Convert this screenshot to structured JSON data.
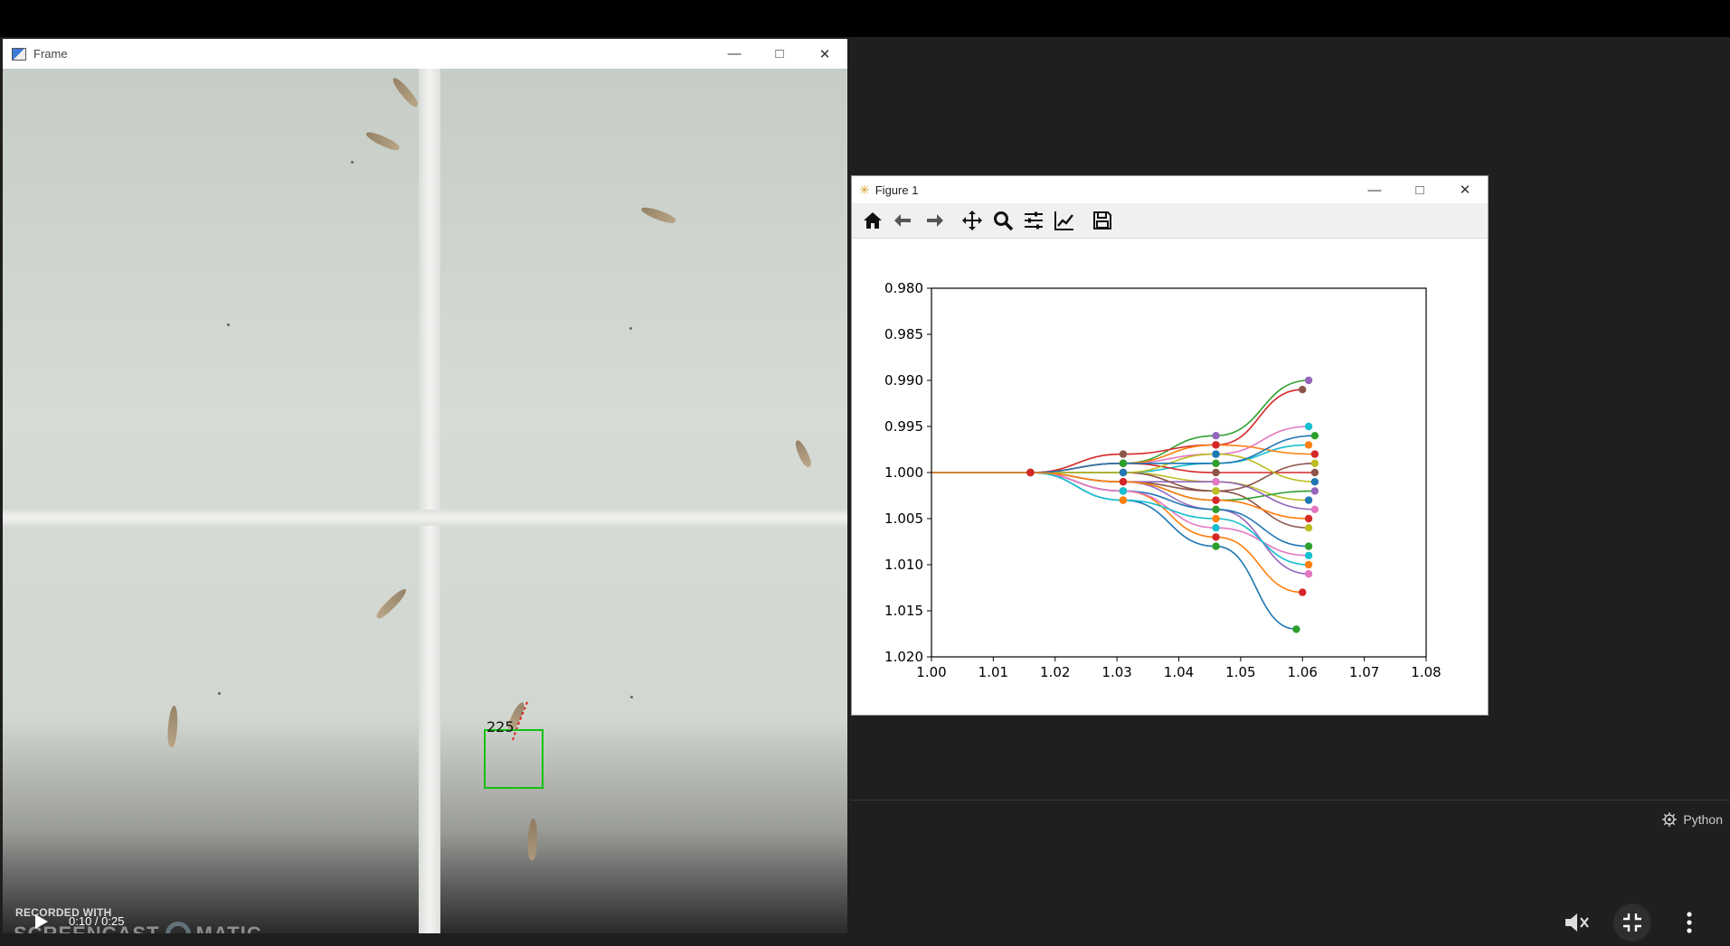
{
  "frame_window": {
    "title": "Frame",
    "track_label": "225"
  },
  "video_player": {
    "watermark_line1": "RECORDED WITH",
    "watermark_logo_left": "SCREENCAST",
    "watermark_logo_right": "MATIC",
    "time": "0:10 / 0:25"
  },
  "figure_window": {
    "title": "Figure 1",
    "toolbar": [
      "home-icon",
      "back-arrow-icon",
      "forward-arrow-icon",
      "pan-icon",
      "zoom-icon",
      "configure-subplots-icon",
      "edit-axis-icon",
      "save-icon"
    ]
  },
  "status_bar": {
    "language": "Python"
  },
  "chart_data": {
    "type": "line",
    "title": "",
    "xlabel": "",
    "ylabel": "",
    "xlim": [
      1.0,
      1.08
    ],
    "ylim": [
      0.98,
      1.02
    ],
    "y_inverted": true,
    "x_ticks": [
      "1.00",
      "1.01",
      "1.02",
      "1.03",
      "1.04",
      "1.05",
      "1.06",
      "1.07",
      "1.08"
    ],
    "y_ticks": [
      "0.980",
      "0.985",
      "0.990",
      "0.995",
      "1.000",
      "1.005",
      "1.010",
      "1.015",
      "1.020"
    ],
    "grid": false,
    "colors": [
      "#1f77b4",
      "#ff7f0e",
      "#2ca02c",
      "#d62728",
      "#9467bd",
      "#8c564b",
      "#e377c2",
      "#bcbd22",
      "#17becf"
    ],
    "series": [
      {
        "x": [
          1.0,
          1.016,
          1.031,
          1.046,
          1.059
        ],
        "y": [
          1.0,
          1.0,
          1.003,
          1.008,
          1.017
        ]
      },
      {
        "x": [
          1.0,
          1.016,
          1.031,
          1.046,
          1.06
        ],
        "y": [
          1.0,
          1.0,
          1.002,
          1.007,
          1.013
        ]
      },
      {
        "x": [
          1.0,
          1.016,
          1.031,
          1.046,
          1.061
        ],
        "y": [
          1.0,
          1.0,
          0.999,
          0.996,
          0.99
        ]
      },
      {
        "x": [
          1.0,
          1.016,
          1.031,
          1.046,
          1.06
        ],
        "y": [
          1.0,
          1.0,
          0.998,
          0.997,
          0.991
        ]
      },
      {
        "x": [
          1.0,
          1.016,
          1.031,
          1.046,
          1.061
        ],
        "y": [
          1.0,
          1.0,
          1.001,
          1.004,
          1.011
        ]
      },
      {
        "x": [
          1.0,
          1.016,
          1.031,
          1.046,
          1.061
        ],
        "y": [
          1.0,
          1.0,
          1.001,
          1.002,
          1.006
        ]
      },
      {
        "x": [
          1.0,
          1.016,
          1.031,
          1.046,
          1.061
        ],
        "y": [
          1.0,
          1.0,
          0.999,
          0.998,
          0.995
        ]
      },
      {
        "x": [
          1.0,
          1.016,
          1.031,
          1.046,
          1.061
        ],
        "y": [
          1.0,
          1.0,
          1.0,
          1.001,
          1.003
        ]
      },
      {
        "x": [
          1.0,
          1.016,
          1.031,
          1.046,
          1.061
        ],
        "y": [
          1.0,
          1.0,
          1.0,
          0.999,
          0.997
        ]
      },
      {
        "x": [
          1.0,
          1.016,
          1.031,
          1.046,
          1.061
        ],
        "y": [
          1.0,
          1.0,
          1.002,
          1.004,
          1.008
        ]
      },
      {
        "x": [
          1.0,
          1.016,
          1.031,
          1.046,
          1.062
        ],
        "y": [
          1.0,
          1.0,
          0.999,
          0.997,
          0.998
        ]
      },
      {
        "x": [
          1.0,
          1.016,
          1.031,
          1.046,
          1.062
        ],
        "y": [
          1.0,
          1.0,
          1.001,
          1.003,
          1.002
        ]
      },
      {
        "x": [
          1.0,
          1.016,
          1.031,
          1.046,
          1.062
        ],
        "y": [
          1.0,
          1.0,
          0.999,
          1.0,
          1.0
        ]
      },
      {
        "x": [
          1.0,
          1.016,
          1.031,
          1.046,
          1.062
        ],
        "y": [
          1.0,
          1.0,
          1.001,
          1.001,
          1.004
        ]
      },
      {
        "x": [
          1.0,
          1.016,
          1.031,
          1.046,
          1.062
        ],
        "y": [
          1.0,
          1.0,
          1.0,
          1.002,
          0.999
        ]
      },
      {
        "x": [
          1.0,
          1.016,
          1.031,
          1.046,
          1.061
        ],
        "y": [
          1.0,
          1.0,
          1.002,
          1.006,
          1.009
        ]
      },
      {
        "x": [
          1.0,
          1.016,
          1.031,
          1.046,
          1.062
        ],
        "y": [
          1.0,
          1.0,
          1.0,
          0.998,
          1.001
        ]
      },
      {
        "x": [
          1.0,
          1.016,
          1.031,
          1.046,
          1.061
        ],
        "y": [
          1.0,
          1.0,
          1.003,
          1.005,
          1.01
        ]
      },
      {
        "x": [
          1.0,
          1.016,
          1.031,
          1.046,
          1.062
        ],
        "y": [
          1.0,
          1.0,
          0.999,
          0.999,
          0.996
        ]
      },
      {
        "x": [
          1.0,
          1.016,
          1.031,
          1.046,
          1.061
        ],
        "y": [
          1.0,
          1.0,
          1.001,
          1.003,
          1.005
        ]
      }
    ]
  }
}
